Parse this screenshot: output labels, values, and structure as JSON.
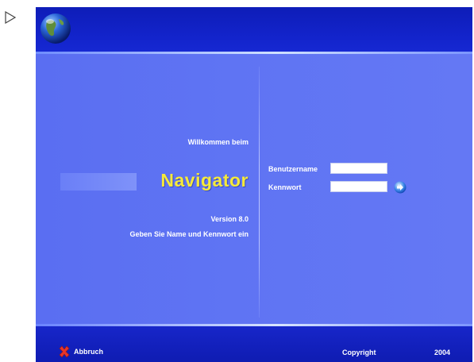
{
  "header": {
    "logo_icon": "globe-icon"
  },
  "welcome": {
    "greeting": "Willkommen beim",
    "product_name": "Navigator",
    "version": "Version  8.0",
    "instruction": "Geben Sie Name und Kennwort ein"
  },
  "login": {
    "username_label": "Benutzername",
    "username_value": "",
    "password_label": "Kennwort",
    "password_value": "",
    "submit_icon": "arrow-right-icon"
  },
  "footer": {
    "cancel_label": "Abbruch",
    "cancel_icon": "red-x-icon",
    "copyright_label": "Copyright",
    "year": "2004"
  },
  "colors": {
    "header_blue": "#1324cc",
    "main_blue": "#5f74f3",
    "brand_yellow": "#f5e93a",
    "cancel_red": "#e8352a"
  }
}
